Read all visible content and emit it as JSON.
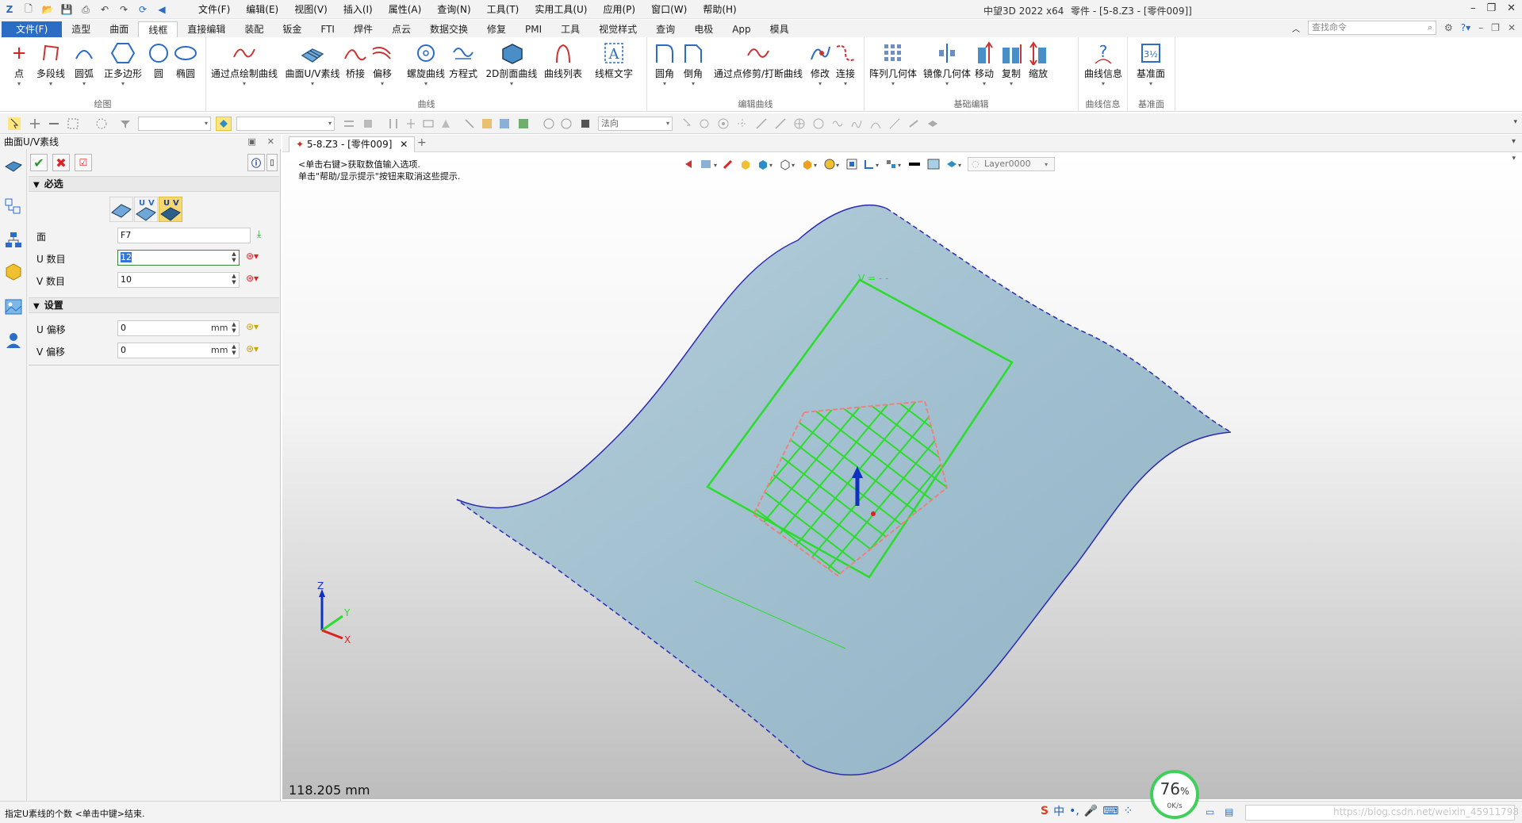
{
  "titlebar": {
    "menu": [
      "文件(F)",
      "编辑(E)",
      "视图(V)",
      "插入(I)",
      "属性(A)",
      "查询(N)",
      "工具(T)",
      "实用工具(U)",
      "应用(P)",
      "窗口(W)",
      "帮助(H)"
    ],
    "app_name": "中望3D 2022 x64",
    "document_title": "零件 - [5-8.Z3 - [零件009]]"
  },
  "ribbon_tabs": [
    "文件(F)",
    "造型",
    "曲面",
    "线框",
    "直接编辑",
    "装配",
    "钣金",
    "FTI",
    "焊件",
    "点云",
    "数据交换",
    "修复",
    "PMI",
    "工具",
    "视觉样式",
    "查询",
    "电极",
    "App",
    "模具"
  ],
  "active_tab": "线框",
  "search": {
    "placeholder": "查找命令"
  },
  "ribbon": {
    "draw_group": {
      "title": "绘图",
      "buttons": [
        "点",
        "多段线",
        "圆弧",
        "正多边形",
        "圆",
        "椭圆"
      ]
    },
    "curve_group": {
      "title": "曲线",
      "buttons": [
        "通过点绘制曲线",
        "曲面U/V素线",
        "桥接",
        "偏移",
        "螺旋曲线",
        "方程式",
        "2D剖面曲线",
        "曲线列表",
        "线框文字"
      ]
    },
    "edit_group": {
      "title": "编辑曲线",
      "buttons": [
        "圆角",
        "倒角",
        "通过点修剪/打断曲线",
        "修改",
        "连接"
      ]
    },
    "basic_edit_group": {
      "title": "基础编辑",
      "buttons": [
        "阵列几何体",
        "镜像几何体",
        "移动",
        "复制",
        "缩放"
      ]
    },
    "info_group": {
      "title": "曲线信息",
      "buttons": [
        "曲线信息"
      ]
    },
    "plane_group": {
      "title": "基准面",
      "buttons": [
        "基准面"
      ]
    }
  },
  "toolbar2": {
    "direction_combo": "法向"
  },
  "panel": {
    "title": "曲面U/V素线",
    "required_section": "必选",
    "settings_section": "设置",
    "fields": {
      "face_label": "面",
      "face_value": "F7",
      "u_count_label": "U 数目",
      "u_count_value": "12",
      "v_count_label": "V 数目",
      "v_count_value": "10",
      "u_offset_label": "U 偏移",
      "u_offset_value": "0",
      "v_offset_label": "V 偏移",
      "v_offset_value": "0",
      "unit": "mm"
    }
  },
  "doc_tab": {
    "title": "5-8.Z3 - [零件009]"
  },
  "viewport": {
    "prompt_line1": "<单击右键>获取数值输入选项.",
    "prompt_line2": "单击\"帮助/显示提示\"按钮来取消这些提示.",
    "layer": "Layer0000",
    "scale_text": "118.205 mm",
    "axis_labels": {
      "x": "X",
      "y": "Y",
      "z": "Z"
    },
    "v_label": "V = - -"
  },
  "statusbar": {
    "message": "指定U素线的个数 <单击中键>结束.",
    "perf_percent": "76",
    "perf_percent_sign": "%",
    "perf_rate": "0K/s",
    "watermark": "https://blog.csdn.net/weixin_45911798"
  },
  "colors": {
    "surface": "#a3c1cf",
    "grid": "#2bdc2b",
    "boundary": "#f08080",
    "accent": "#2b6cc4"
  }
}
